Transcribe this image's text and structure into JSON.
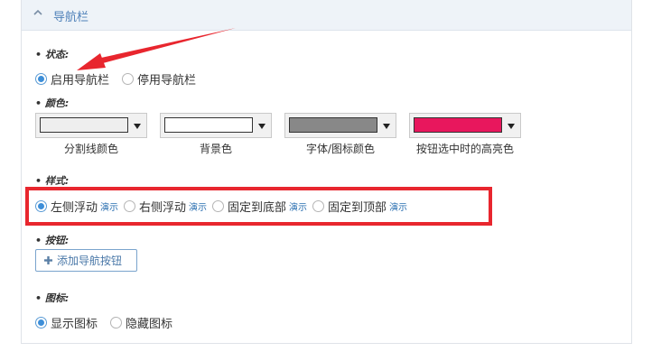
{
  "panel": {
    "title": "导航栏",
    "collapse_icon": "chevron-up-icon"
  },
  "status": {
    "label": "• 状态:",
    "options": [
      {
        "label": "启用导航栏",
        "checked": true
      },
      {
        "label": "停用导航栏",
        "checked": false
      }
    ]
  },
  "colors": {
    "label": "• 颜色:",
    "pickers": [
      {
        "caption": "分割线颜色",
        "value": "#eeeeee"
      },
      {
        "caption": "背景色",
        "value": "#ffffff"
      },
      {
        "caption": "字体/图标颜色",
        "value": "#888888"
      },
      {
        "caption": "按钮选中时的高亮色",
        "value": "#e8175d"
      }
    ]
  },
  "style": {
    "label": "• 样式:",
    "demo_label": "演示",
    "options": [
      {
        "label": "左侧浮动",
        "checked": true
      },
      {
        "label": "右侧浮动",
        "checked": false
      },
      {
        "label": "固定到底部",
        "checked": false
      },
      {
        "label": "固定到顶部",
        "checked": false
      }
    ]
  },
  "buttons": {
    "label": "• 按钮:",
    "add_label": "添加导航按钮",
    "add_icon": "plus-icon"
  },
  "icons": {
    "label": "• 图标:",
    "options": [
      {
        "label": "显示图标",
        "checked": true
      },
      {
        "label": "隐藏图标",
        "checked": false
      }
    ]
  },
  "annotation_colors": {
    "arrow": "#e8262e",
    "highlight_box": "#e8262e"
  }
}
